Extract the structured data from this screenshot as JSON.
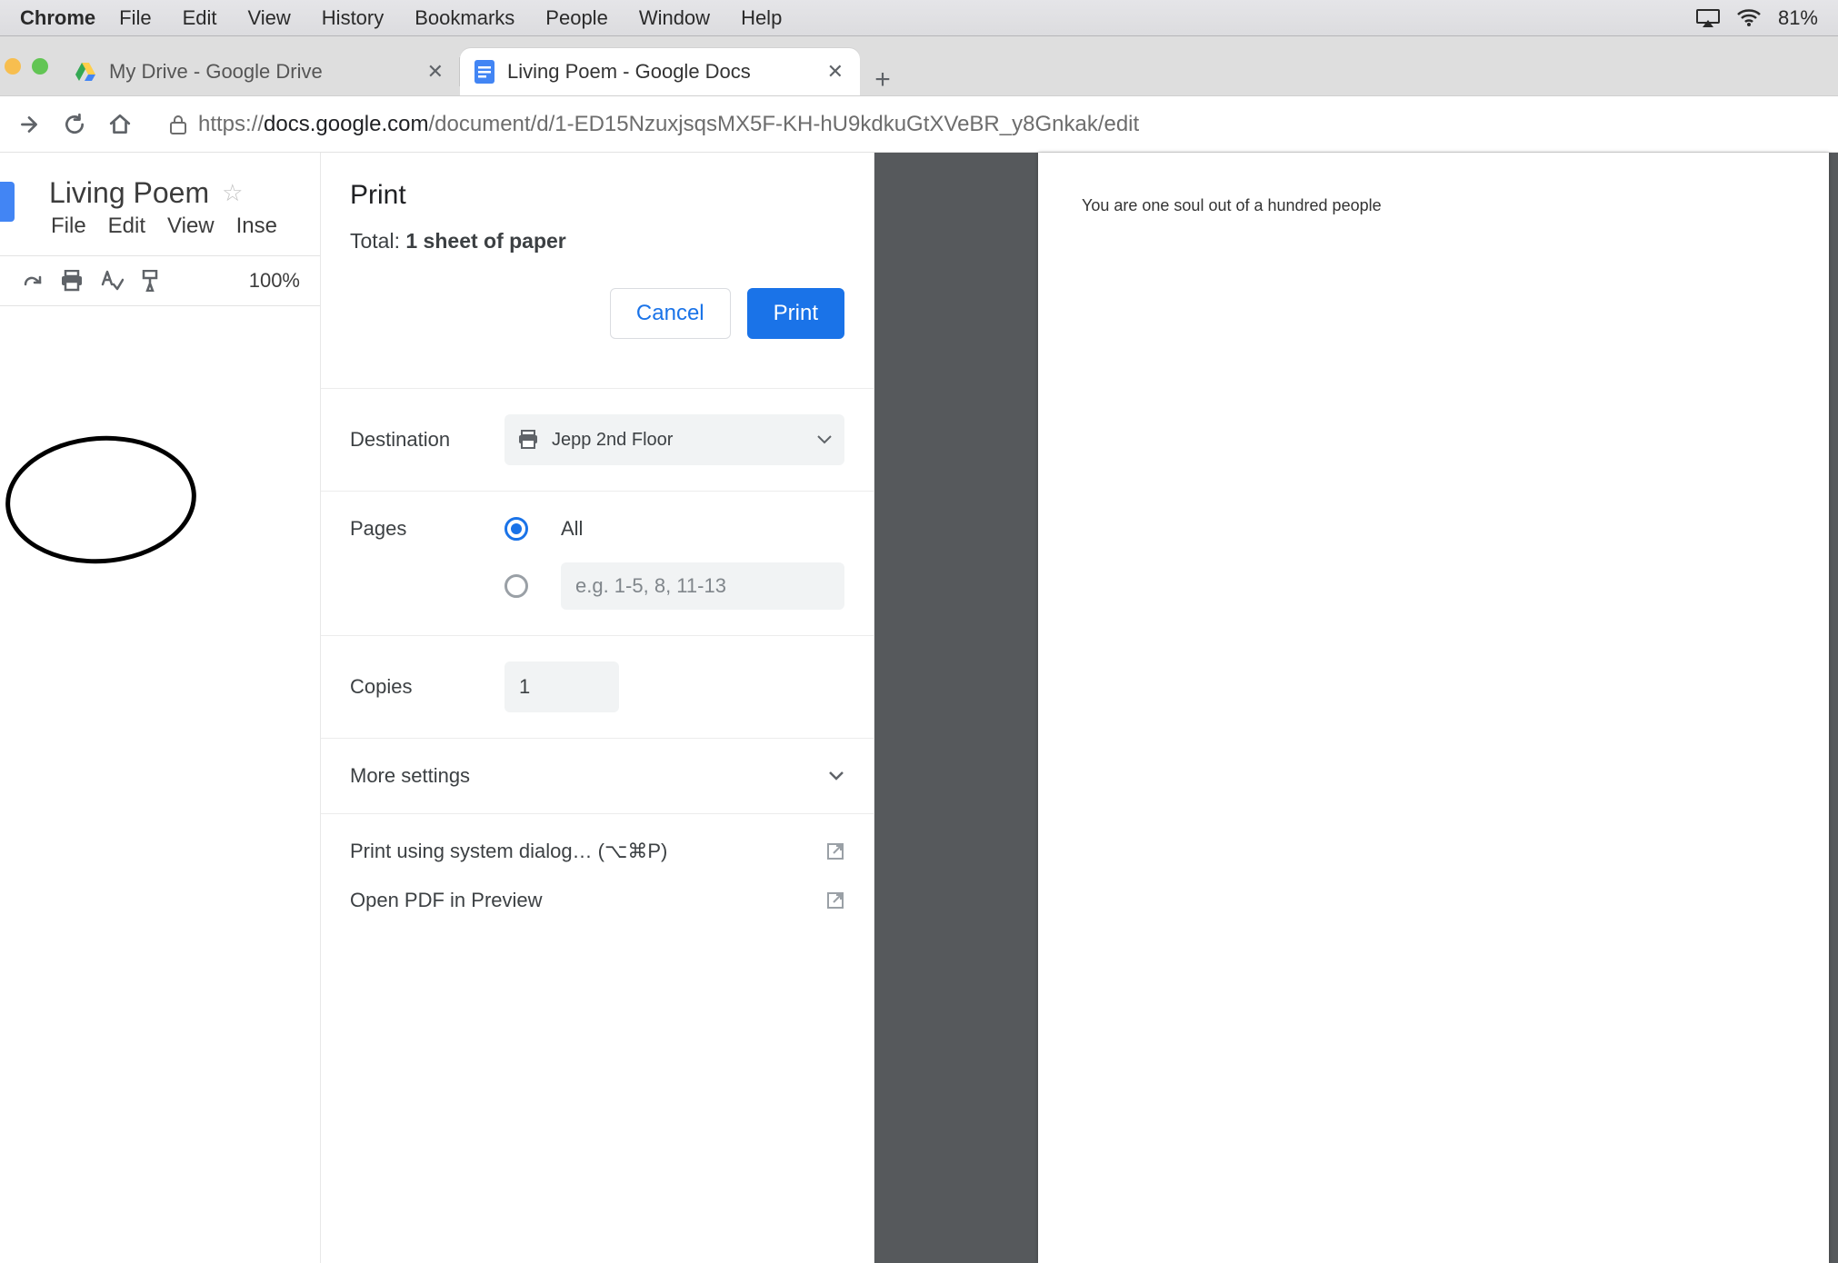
{
  "menubar": {
    "app": "Chrome",
    "items": [
      "File",
      "Edit",
      "View",
      "History",
      "Bookmarks",
      "People",
      "Window",
      "Help"
    ],
    "battery": "81%"
  },
  "tabs": {
    "tab1": {
      "title": "My Drive - Google Drive"
    },
    "tab2": {
      "title": "Living Poem - Google Docs"
    }
  },
  "address": {
    "scheme": "https://",
    "host": "docs.google.com",
    "path": "/document/d/1-ED15NzuxjsqsMX5F-KH-hU9kdkuGtXVeBR_y8Gnkak/edit"
  },
  "docs": {
    "title": "Living Poem",
    "menus": [
      "File",
      "Edit",
      "View",
      "Inse"
    ],
    "zoom": "100%"
  },
  "print": {
    "title": "Print",
    "total_prefix": "Total: ",
    "total_value": "1 sheet of paper",
    "cancel": "Cancel",
    "print_btn": "Print",
    "destination_label": "Destination",
    "destination_value": "Jepp 2nd Floor",
    "pages_label": "Pages",
    "pages_all": "All",
    "pages_range_placeholder": "e.g. 1-5, 8, 11-13",
    "copies_label": "Copies",
    "copies_value": "1",
    "more_settings": "More settings",
    "system_dialog": "Print using system dialog… (⌥⌘P)",
    "open_pdf": "Open PDF in Preview"
  },
  "preview": {
    "line1": "You are one soul out of a hundred people"
  }
}
